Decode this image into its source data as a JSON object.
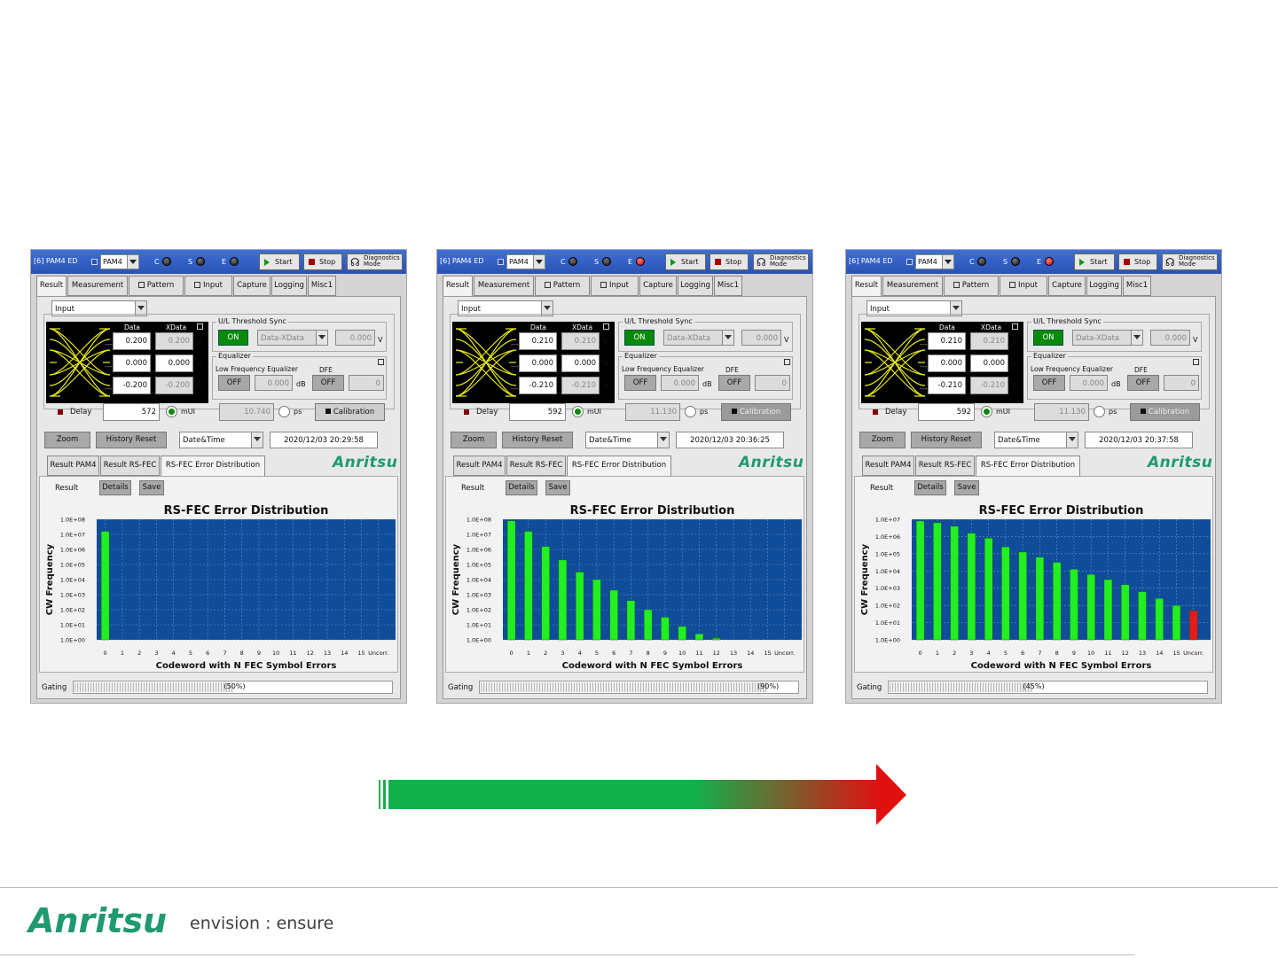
{
  "panels": [
    {
      "titlebar": {
        "title": "[6] PAM4 ED",
        "mode": "PAM4",
        "led_c": "C",
        "led_s": "S",
        "led_e": "E",
        "start": "Start",
        "stop": "Stop",
        "diag1": "Diagnostics",
        "diag2": "Mode"
      },
      "tabs": [
        "Result",
        "Measurement",
        "Pattern",
        "Input",
        "Capture",
        "Logging",
        "Misc1"
      ],
      "input_select": "Input",
      "eye": {
        "data_hdr": "Data",
        "xdata_hdr": "XData",
        "data": [
          "0.200",
          "0.000",
          "-0.200"
        ],
        "xdata": [
          "0.200",
          "0.000",
          "-0.200"
        ],
        "unit": "V"
      },
      "threshold": {
        "label": "U/L Threshold Sync",
        "on": "ON",
        "select": "Data-XData",
        "value": "0.000",
        "unit": "V"
      },
      "equalizer": {
        "label": "Equalizer",
        "lfe_label": "Low Frequency Equalizer",
        "dfe_label": "DFE",
        "lfe_btn": "OFF",
        "lfe_value": "0.000",
        "db": "dB",
        "dfe_btn": "OFF",
        "dfe_value": "0"
      },
      "delay": {
        "label": "Delay",
        "value": "572",
        "mui": "mUI",
        "ps_value": "10.740",
        "ps": "ps",
        "calibration": "Calibration"
      },
      "toolbar": {
        "zoom": "Zoom",
        "history_reset": "History Reset",
        "datetime_select": "Date&Time",
        "timestamp": "2020/12/03 20:29:58"
      },
      "subtabs": [
        "Result PAM4",
        "Result RS-FEC",
        "RS-FEC Error Distribution"
      ],
      "logo": "Anritsu",
      "result": {
        "label": "Result",
        "details": "Details",
        "save": "Save"
      },
      "gating": {
        "label": "Gating",
        "text": "(50%)",
        "progress": 0.5
      },
      "chart_data": {
        "type": "bar",
        "title": "RS-FEC Error Distribution",
        "xlabel": "Codeword with N FEC Symbol Errors",
        "ylabel": "CW Frequency",
        "yscale": "log",
        "ytick_labels": [
          "1.0E+00",
          "1.0E+01",
          "1.0E+02",
          "1.0E+03",
          "1.0E+04",
          "1.0E+05",
          "1.0E+06",
          "1.0E+07",
          "1.0E+08"
        ],
        "ylim_exp": [
          0,
          8
        ],
        "categories": [
          "0",
          "1",
          "2",
          "3",
          "4",
          "5",
          "6",
          "7",
          "8",
          "9",
          "10",
          "11",
          "12",
          "13",
          "14",
          "15",
          "Uncorr."
        ],
        "log10_values": [
          7.2,
          null,
          null,
          null,
          null,
          null,
          null,
          null,
          null,
          null,
          null,
          null,
          null,
          null,
          null,
          null,
          null
        ],
        "bar_color": "#22ee22",
        "uncorrectable_color": "#e61a1a",
        "plot_bg": "#0f4c9a"
      }
    },
    {
      "titlebar": {
        "title": "[6] PAM4 ED",
        "mode": "PAM4",
        "led_c": "C",
        "led_s": "S",
        "led_e": "E",
        "start": "Start",
        "stop": "Stop",
        "diag1": "Diagnostics",
        "diag2": "Mode"
      },
      "tabs": [
        "Result",
        "Measurement",
        "Pattern",
        "Input",
        "Capture",
        "Logging",
        "Misc1"
      ],
      "input_select": "Input",
      "eye": {
        "data_hdr": "Data",
        "xdata_hdr": "XData",
        "data": [
          "0.210",
          "0.000",
          "-0.210"
        ],
        "xdata": [
          "0.210",
          "0.000",
          "-0.210"
        ],
        "unit": "V"
      },
      "threshold": {
        "label": "U/L Threshold Sync",
        "on": "ON",
        "select": "Data-XData",
        "value": "0.000",
        "unit": "V"
      },
      "equalizer": {
        "label": "Equalizer",
        "lfe_label": "Low Frequency Equalizer",
        "dfe_label": "DFE",
        "lfe_btn": "OFF",
        "lfe_value": "0.000",
        "db": "dB",
        "dfe_btn": "OFF",
        "dfe_value": "0"
      },
      "delay": {
        "label": "Delay",
        "value": "592",
        "mui": "mUI",
        "ps_value": "11.130",
        "ps": "ps",
        "calibration": "Calibration"
      },
      "toolbar": {
        "zoom": "Zoom",
        "history_reset": "History Reset",
        "datetime_select": "Date&Time",
        "timestamp": "2020/12/03 20:36:25"
      },
      "subtabs": [
        "Result PAM4",
        "Result RS-FEC",
        "RS-FEC Error Distribution"
      ],
      "logo": "Anritsu",
      "result": {
        "label": "Result",
        "details": "Details",
        "save": "Save"
      },
      "gating": {
        "label": "Gating",
        "text": "(90%)",
        "progress": 0.9
      },
      "chart_data": {
        "type": "bar",
        "title": "RS-FEC Error Distribution",
        "xlabel": "Codeword with N FEC Symbol Errors",
        "ylabel": "CW Frequency",
        "yscale": "log",
        "ytick_labels": [
          "1.0E+00",
          "1.0E+01",
          "1.0E+02",
          "1.0E+03",
          "1.0E+04",
          "1.0E+05",
          "1.0E+06",
          "1.0E+07",
          "1.0E+08"
        ],
        "ylim_exp": [
          0,
          8
        ],
        "categories": [
          "0",
          "1",
          "2",
          "3",
          "4",
          "5",
          "6",
          "7",
          "8",
          "9",
          "10",
          "11",
          "12",
          "13",
          "14",
          "15",
          "Uncorr."
        ],
        "log10_values": [
          7.9,
          7.2,
          6.2,
          5.3,
          4.5,
          4.0,
          3.3,
          2.6,
          2.0,
          1.5,
          0.9,
          0.4,
          0.1,
          null,
          null,
          null,
          null
        ],
        "bar_color": "#22ee22",
        "uncorrectable_color": "#e61a1a",
        "plot_bg": "#0f4c9a"
      }
    },
    {
      "titlebar": {
        "title": "[6] PAM4 ED",
        "mode": "PAM4",
        "led_c": "C",
        "led_s": "S",
        "led_e": "E",
        "start": "Start",
        "stop": "Stop",
        "diag1": "Diagnostics",
        "diag2": "Mode"
      },
      "tabs": [
        "Result",
        "Measurement",
        "Pattern",
        "Input",
        "Capture",
        "Logging",
        "Misc1"
      ],
      "input_select": "Input",
      "eye": {
        "data_hdr": "Data",
        "xdata_hdr": "XData",
        "data": [
          "0.210",
          "0.000",
          "-0.210"
        ],
        "xdata": [
          "0.210",
          "0.000",
          "-0.210"
        ],
        "unit": "V"
      },
      "threshold": {
        "label": "U/L Threshold Sync",
        "on": "ON",
        "select": "Data-XData",
        "value": "0.000",
        "unit": "V"
      },
      "equalizer": {
        "label": "Equalizer",
        "lfe_label": "Low Frequency Equalizer",
        "dfe_label": "DFE",
        "lfe_btn": "OFF",
        "lfe_value": "0.000",
        "db": "dB",
        "dfe_btn": "OFF",
        "dfe_value": "0"
      },
      "delay": {
        "label": "Delay",
        "value": "592",
        "mui": "mUI",
        "ps_value": "11.130",
        "ps": "ps",
        "calibration": "Calibration"
      },
      "toolbar": {
        "zoom": "Zoom",
        "history_reset": "History Reset",
        "datetime_select": "Date&Time",
        "timestamp": "2020/12/03 20:37:58"
      },
      "subtabs": [
        "Result PAM4",
        "Result RS-FEC",
        "RS-FEC Error Distribution"
      ],
      "logo": "Anritsu",
      "result": {
        "label": "Result",
        "details": "Details",
        "save": "Save"
      },
      "gating": {
        "label": "Gating",
        "text": "(45%)",
        "progress": 0.45
      },
      "chart_data": {
        "type": "bar",
        "title": "RS-FEC Error Distribution",
        "xlabel": "Codeword with N FEC Symbol Errors",
        "ylabel": "CW Frequency",
        "yscale": "log",
        "ytick_labels": [
          "1.0E+00",
          "1.0E+01",
          "1.0E+02",
          "1.0E+03",
          "1.0E+04",
          "1.0E+05",
          "1.0E+06",
          "1.0E+07"
        ],
        "ylim_exp": [
          0,
          7
        ],
        "categories": [
          "0",
          "1",
          "2",
          "3",
          "4",
          "5",
          "6",
          "7",
          "8",
          "9",
          "10",
          "11",
          "12",
          "13",
          "14",
          "15",
          "Uncorr."
        ],
        "log10_values": [
          6.9,
          6.8,
          6.6,
          6.2,
          5.9,
          5.4,
          5.1,
          4.8,
          4.5,
          4.1,
          3.8,
          3.5,
          3.2,
          2.8,
          2.4,
          2.0,
          1.7
        ],
        "bar_color": "#22ee22",
        "uncorrectable_color": "#e61a1a",
        "plot_bg": "#0f4c9a"
      }
    }
  ],
  "arrow": {
    "start_color": "#12b04c",
    "end_color": "#e01010"
  },
  "footer": {
    "logo": "Anritsu",
    "tagline": "envision : ensure",
    "brand_color": "#1f9a6e"
  }
}
